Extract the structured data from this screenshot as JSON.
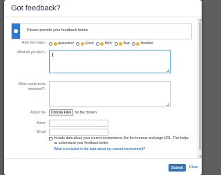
{
  "dialog": {
    "title": "Got feedback?"
  },
  "info": {
    "message": "Please provide your feedback below"
  },
  "rating": {
    "label": "Rate this page",
    "options": [
      "Awesome!",
      "Good",
      "Meh!",
      "Bad",
      "Horrible!"
    ]
  },
  "fields": {
    "like_label": "What do you like?",
    "improve_label": "What needs to be improved?",
    "attach_label": "Attach file",
    "choose_files_label": "Choose Files",
    "no_file_text": "No file chosen",
    "name_label": "Name",
    "email_label": "Email",
    "required_marker": "*"
  },
  "environment": {
    "text": "Include data about your current environment, like the browser and page URL. This helps us understand your feedback better.",
    "link": "What is included in the data about my current environment?"
  },
  "footer": {
    "submit_label": "Submit",
    "close_label": "Close"
  },
  "colors": {
    "accent": "#2e7ad1",
    "submit": "#3572b0",
    "link": "#0052cc",
    "emoji": "#f0b323"
  }
}
